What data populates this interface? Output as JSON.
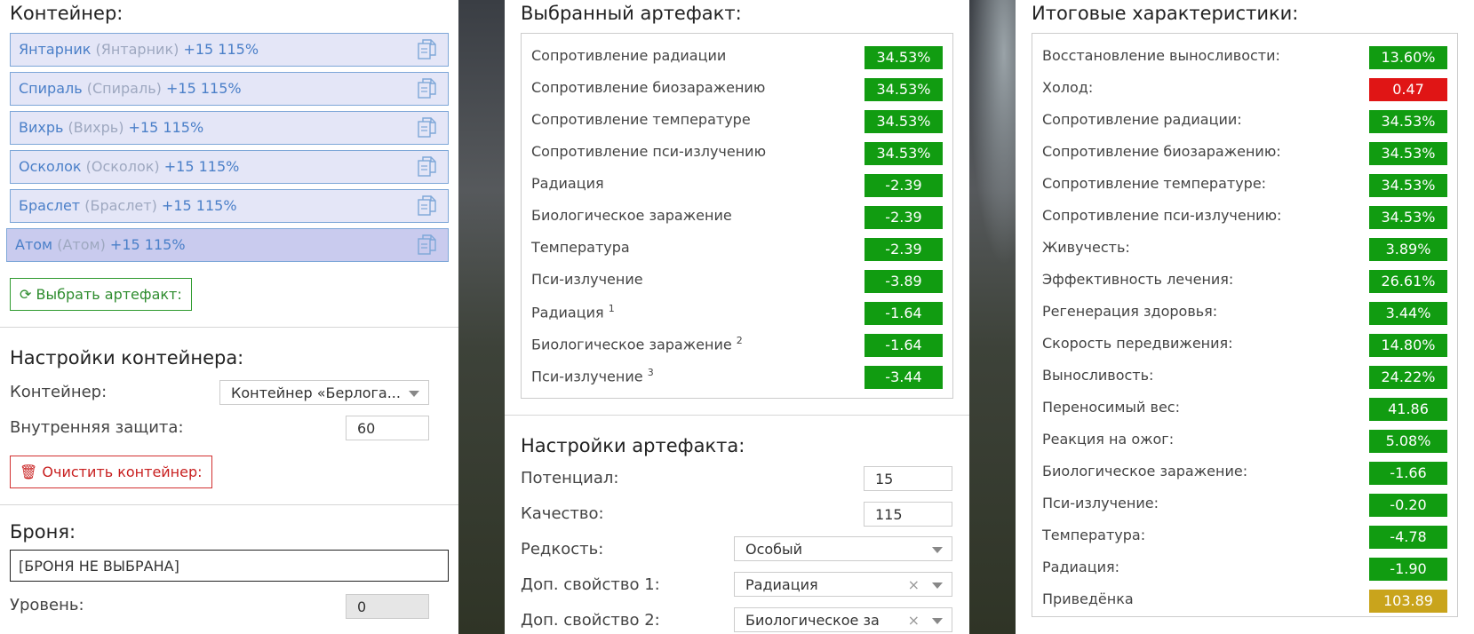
{
  "container": {
    "title": "Контейнер:",
    "items": [
      {
        "name": "Янтарник",
        "orig": "(Янтарник)",
        "bonus": "+15 115%"
      },
      {
        "name": "Спираль",
        "orig": "(Спираль)",
        "bonus": "+15 115%"
      },
      {
        "name": "Вихрь",
        "orig": "(Вихрь)",
        "bonus": "+15 115%"
      },
      {
        "name": "Осколок",
        "orig": "(Осколок)",
        "bonus": "+15 115%"
      },
      {
        "name": "Браслет",
        "orig": "(Браслет)",
        "bonus": "+15 115%"
      },
      {
        "name": "Атом",
        "orig": "(Атом)",
        "bonus": "+15 115%"
      }
    ],
    "choose_button": "Выбрать артефакт:"
  },
  "container_settings": {
    "title": "Настройки контейнера:",
    "container_label": "Контейнер:",
    "container_value": "Контейнер «Берлога...",
    "protection_label": "Внутренняя защита:",
    "protection_value": "60",
    "clear_button": "Очистить контейнер:"
  },
  "armor": {
    "title": "Броня:",
    "value": "[БРОНЯ НЕ ВЫБРАНА]",
    "level_label": "Уровень:",
    "level_value": "0"
  },
  "selected": {
    "title": "Выбранный артефакт:",
    "stats": [
      {
        "name": "Сопротивление радиации",
        "sup": "",
        "value": "34.53%",
        "color": "green"
      },
      {
        "name": "Сопротивление биозаражению",
        "sup": "",
        "value": "34.53%",
        "color": "green"
      },
      {
        "name": "Сопротивление температуре",
        "sup": "",
        "value": "34.53%",
        "color": "green"
      },
      {
        "name": "Сопротивление пси-излучению",
        "sup": "",
        "value": "34.53%",
        "color": "green"
      },
      {
        "name": "Радиация",
        "sup": "",
        "value": "-2.39",
        "color": "green"
      },
      {
        "name": "Биологическое заражение",
        "sup": "",
        "value": "-2.39",
        "color": "green"
      },
      {
        "name": "Температура",
        "sup": "",
        "value": "-2.39",
        "color": "green"
      },
      {
        "name": "Пси-излучение",
        "sup": "",
        "value": "-3.89",
        "color": "green"
      },
      {
        "name": "Радиация",
        "sup": "1",
        "value": "-1.64",
        "color": "green"
      },
      {
        "name": "Биологическое заражение",
        "sup": "2",
        "value": "-1.64",
        "color": "green"
      },
      {
        "name": "Пси-излучение",
        "sup": "3",
        "value": "-3.44",
        "color": "green"
      }
    ]
  },
  "artifact_settings": {
    "title": "Настройки артефакта:",
    "potential_label": "Потенциал:",
    "potential_value": "15",
    "quality_label": "Качество:",
    "quality_value": "115",
    "rarity_label": "Редкость:",
    "rarity_value": "Особый",
    "extra1_label": "Доп. свойство 1:",
    "extra1_value": "Радиация",
    "extra2_label": "Доп. свойство 2:",
    "extra2_value": "Биологическое за",
    "clear_x": "×"
  },
  "totals": {
    "title": "Итоговые характеристики:",
    "stats": [
      {
        "name": "Восстановление выносливости:",
        "value": "13.60%",
        "color": "green"
      },
      {
        "name": "Холод:",
        "value": "0.47",
        "color": "red"
      },
      {
        "name": "Сопротивление радиации:",
        "value": "34.53%",
        "color": "green"
      },
      {
        "name": "Сопротивление биозаражению:",
        "value": "34.53%",
        "color": "green"
      },
      {
        "name": "Сопротивление температуре:",
        "value": "34.53%",
        "color": "green"
      },
      {
        "name": "Сопротивление пси-излучению:",
        "value": "34.53%",
        "color": "green"
      },
      {
        "name": "Живучесть:",
        "value": "3.89%",
        "color": "green"
      },
      {
        "name": "Эффективность лечения:",
        "value": "26.61%",
        "color": "green"
      },
      {
        "name": "Регенерация здоровья:",
        "value": "3.44%",
        "color": "green"
      },
      {
        "name": "Скорость передвижения:",
        "value": "14.80%",
        "color": "green"
      },
      {
        "name": "Выносливость:",
        "value": "24.22%",
        "color": "green"
      },
      {
        "name": "Переносимый вес:",
        "value": "41.86",
        "color": "green"
      },
      {
        "name": "Реакция на ожог:",
        "value": "5.08%",
        "color": "green"
      },
      {
        "name": "Биологическое заражение:",
        "value": "-1.66",
        "color": "green"
      },
      {
        "name": "Пси-излучение:",
        "value": "-0.20",
        "color": "green"
      },
      {
        "name": "Температура:",
        "value": "-4.78",
        "color": "green"
      },
      {
        "name": "Радиация:",
        "value": "-1.90",
        "color": "green"
      },
      {
        "name": "Приведёнка",
        "value": "103.89",
        "color": "gold"
      }
    ]
  },
  "colors": {
    "green": "#119c11",
    "red": "#e01515",
    "gold": "#c9a41c",
    "accent_blue": "#4a7fc8"
  }
}
